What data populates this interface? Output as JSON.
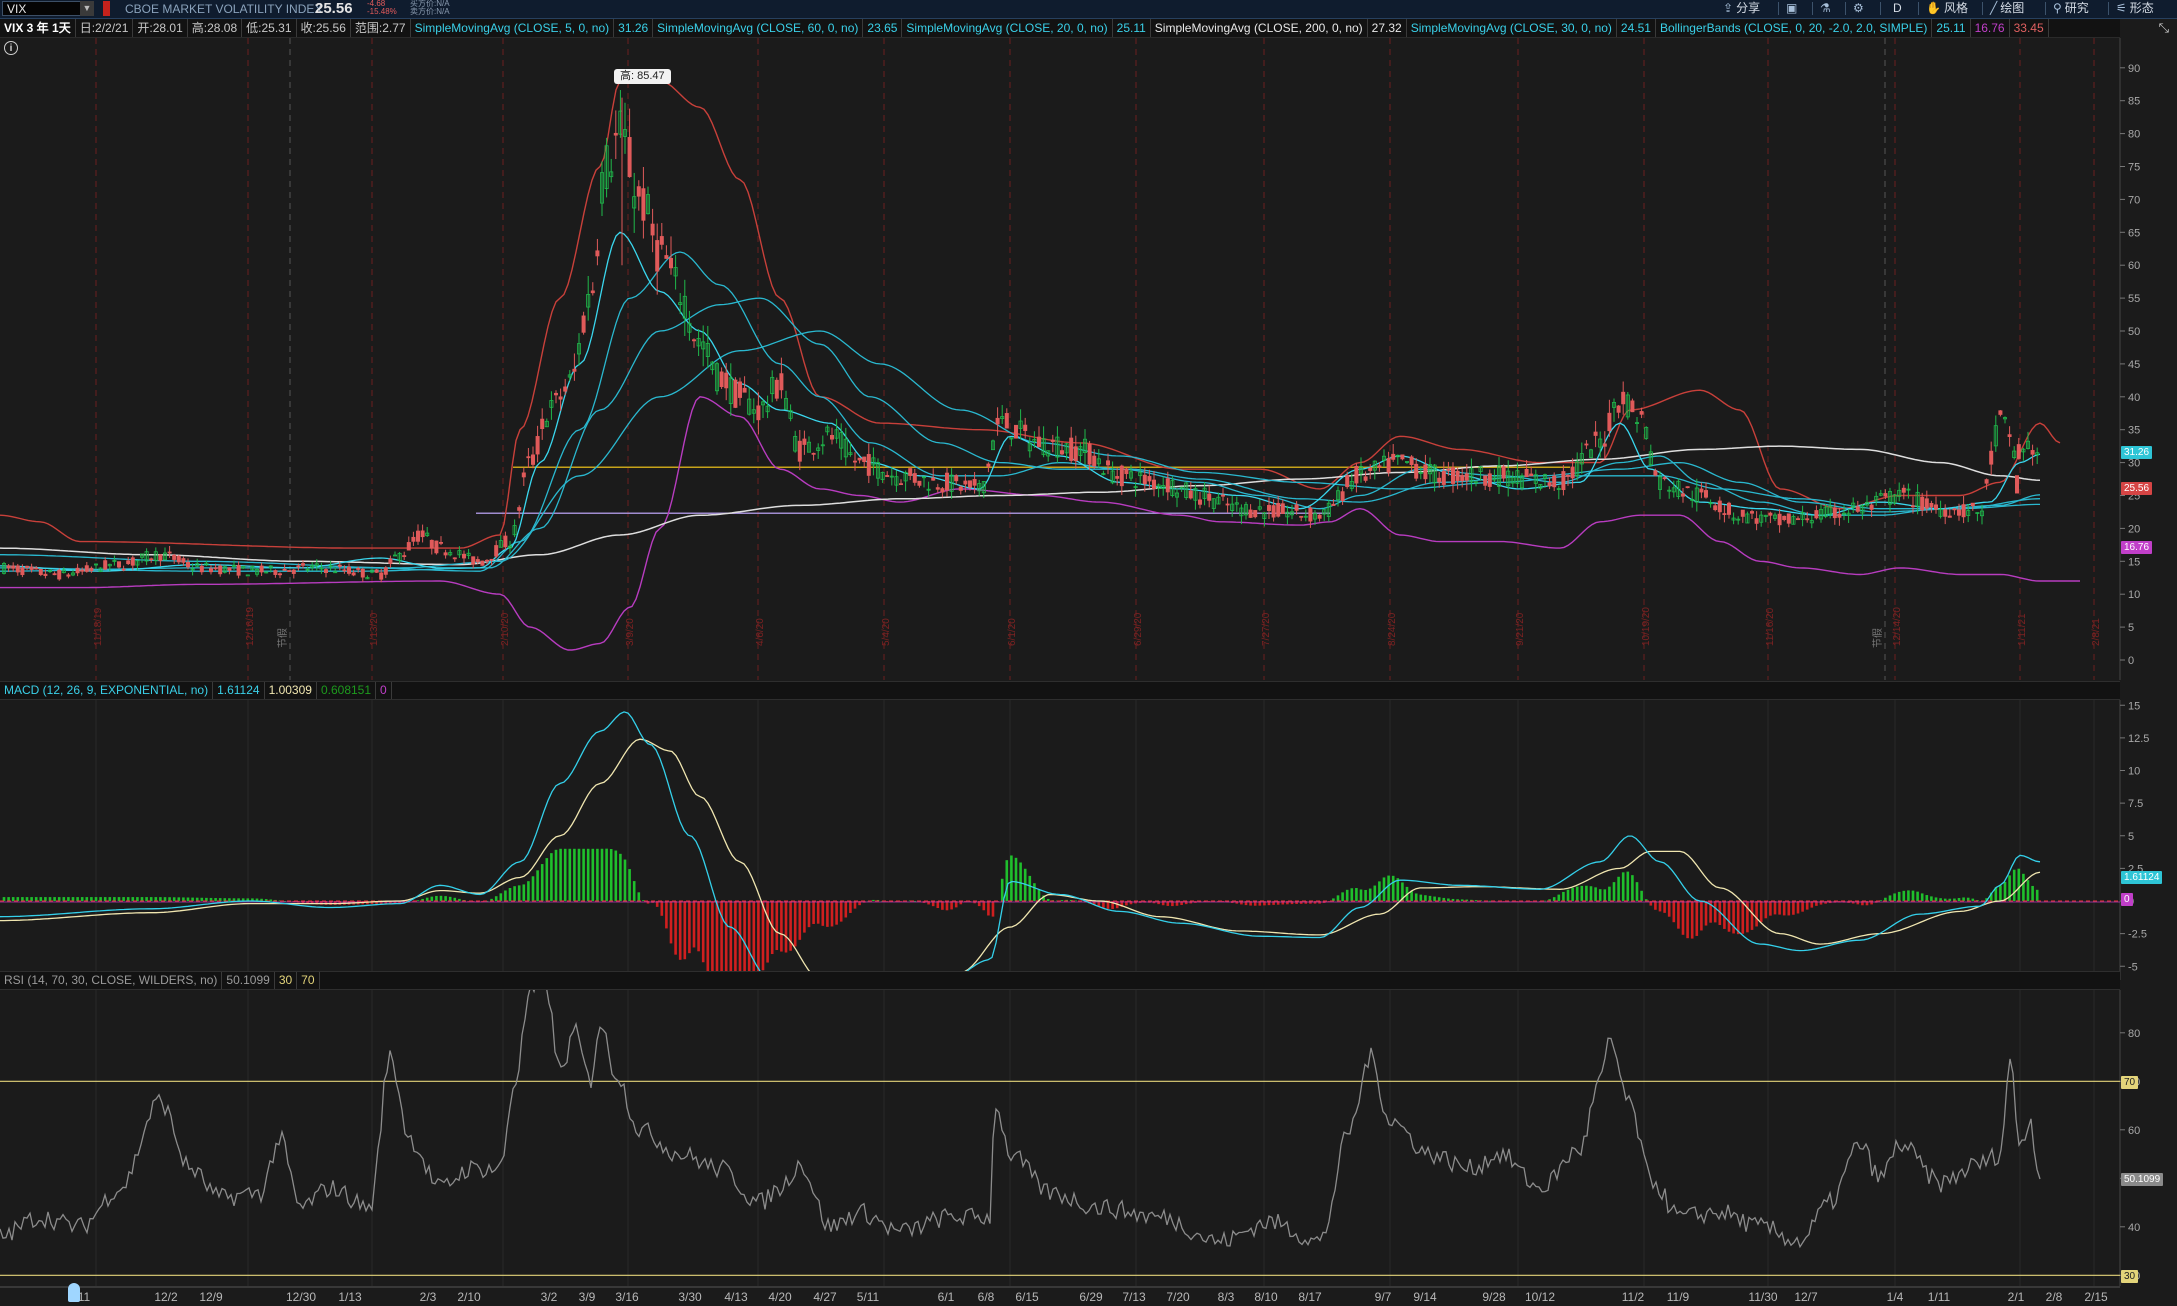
{
  "toolbar": {
    "symbol": "VIX",
    "symbol_name": "CBOE MARKET VOLATILITY INDEX",
    "last_price": "25.56",
    "change": "-4.68",
    "change_pct": "-15.48%",
    "bid": "买方价:N/A",
    "ask": "卖方价:N/A",
    "buttons": [
      {
        "label": "分享",
        "icon": "share-icon"
      },
      {
        "label": "",
        "icon": "layout-icon"
      },
      {
        "label": "",
        "icon": "flask-icon"
      },
      {
        "label": "",
        "icon": "gear-icon"
      },
      {
        "label": "D",
        "icon": "drawing-d-icon"
      },
      {
        "label": "风格",
        "icon": "style-icon"
      },
      {
        "label": "绘图",
        "icon": "draw-icon"
      },
      {
        "label": "研究",
        "icon": "study-icon"
      },
      {
        "label": "形态",
        "icon": "pattern-icon"
      }
    ]
  },
  "legend": {
    "period": "VIX 3 年 1天",
    "date": "日:2/2/21",
    "open": "开:28.01",
    "high": "高:28.08",
    "low": "低:25.31",
    "close": "收:25.56",
    "range": "范围:2.77",
    "studies": [
      {
        "label": "SimpleMovingAvg (CLOSE, 5, 0, no)",
        "value": "31.26",
        "color": "#3ad0e8"
      },
      {
        "label": "SimpleMovingAvg (CLOSE, 60, 0, no)",
        "value": "23.65",
        "color": "#3ad0e8"
      },
      {
        "label": "SimpleMovingAvg (CLOSE, 20, 0, no)",
        "value": "25.11",
        "color": "#3ad0e8"
      },
      {
        "label": "SimpleMovingAvg (CLOSE, 200, 0, no)",
        "value": "27.32",
        "color": "#e8e8e8"
      },
      {
        "label": "SimpleMovingAvg (CLOSE, 30, 0, no)",
        "value": "24.51",
        "color": "#3ad0e8"
      },
      {
        "label": "BollingerBands (CLOSE, 0, 20, -2.0, 2.0, SIMPLE)",
        "value": "25.11",
        "value2": "16.76",
        "value3": "33.45",
        "color": "#3ad0e8"
      }
    ]
  },
  "price_panel": {
    "high_label": "高: 85.47",
    "y_ticks": [
      "90",
      "85",
      "80",
      "75",
      "70",
      "65",
      "60",
      "55",
      "50",
      "45",
      "40",
      "35",
      "30",
      "25",
      "20",
      "15",
      "10",
      "5",
      "0"
    ],
    "tags": [
      {
        "text": "31.26",
        "color": "#2ec5d6"
      },
      {
        "text": "25.56",
        "color": "#d64545"
      },
      {
        "text": "16.76",
        "color": "#c13fc9"
      }
    ],
    "vertical_markers": [
      "11/18/19",
      "12/16/19",
      "1/13/20",
      "2/10/20",
      "3/9/20",
      "4/6/20",
      "5/4/20",
      "6/1/20",
      "6/29/20",
      "7/27/20",
      "8/24/20",
      "9/21/20",
      "10/19/20",
      "11/16/20",
      "12/14/20",
      "1/11/21",
      "2/8/21"
    ],
    "grey_markers": [
      "节假",
      "节假"
    ]
  },
  "macd_panel": {
    "study": "MACD (12, 26, 9, EXPONENTIAL, no)",
    "value": "1.61124",
    "avg": "1.00309",
    "diff": "0.608151",
    "zero": "0",
    "y_ticks": [
      "15",
      "12.5",
      "10",
      "7.5",
      "5",
      "2.5",
      "0",
      "-2.5",
      "-5"
    ],
    "tags": [
      {
        "text": "1.61124",
        "color": "#2ec5d6"
      },
      {
        "text": "0",
        "color": "#c13fc9"
      }
    ]
  },
  "rsi_panel": {
    "study": "RSI (14, 70, 30, CLOSE, WILDERS, no)",
    "value": "50.1099",
    "ob": "30",
    "os": "70",
    "y_ticks": [
      "80",
      "70",
      "60",
      "50",
      "40",
      "30"
    ],
    "tags": [
      {
        "text": "70",
        "color": "#e3d47a"
      },
      {
        "text": "50.1099",
        "color": "#8a8a8a"
      },
      {
        "text": "30",
        "color": "#e3d47a"
      }
    ]
  },
  "x_axis": [
    "11",
    "12/2",
    "12/9",
    "12/30",
    "1/13",
    "2/3",
    "2/10",
    "3/2",
    "3/9",
    "3/16",
    "3/30",
    "4/13",
    "4/20",
    "4/27",
    "5/11",
    "6/1",
    "6/8",
    "6/15",
    "6/29",
    "7/13",
    "7/20",
    "8/3",
    "8/10",
    "8/17",
    "9/7",
    "9/14",
    "9/28",
    "10/12",
    "11/2",
    "11/9",
    "11/30",
    "12/7",
    "1/4",
    "1/11",
    "2/1",
    "2/8",
    "2/15"
  ]
}
